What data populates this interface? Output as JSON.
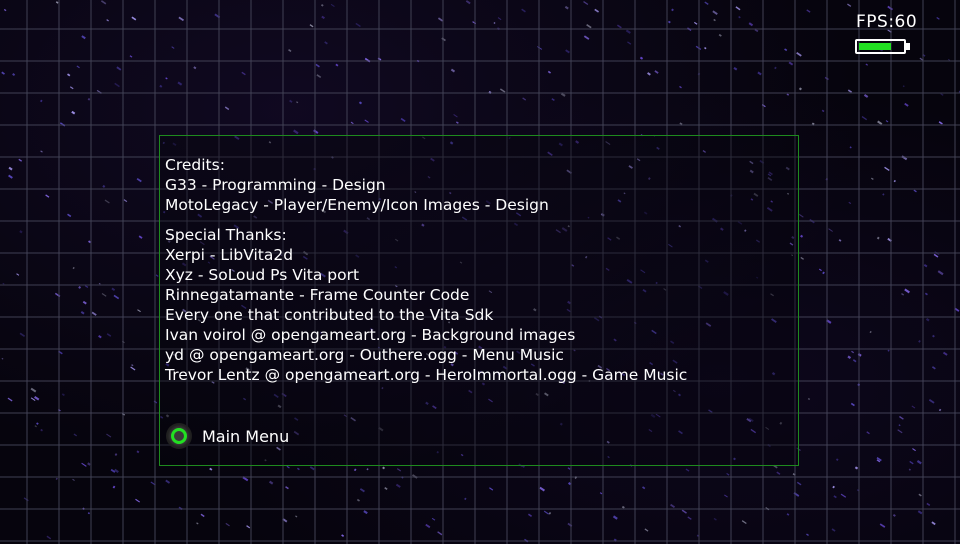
{
  "hud": {
    "fps": "FPS:60",
    "battery_level": 0.75,
    "battery_color": "#22e022"
  },
  "credits": {
    "lines": [
      "Credits:",
      "G33 - Programming - Design",
      "MotoLegacy - Player/Enemy/Icon Images - Design"
    ]
  },
  "thanks": {
    "lines": [
      "Special Thanks:",
      "Xerpi - LibVita2d",
      "Xyz - SoLoud Ps Vita port",
      "Rinnegatamante - Frame Counter Code",
      "Every one that contributed to the Vita Sdk",
      "Ivan voirol @ opengameart.org - Background images",
      "yd @ opengameart.org - Outhere.ogg - Menu Music",
      "Trevor Lentz @ opengameart.org - HeroImmortal.ogg - Game Music"
    ]
  },
  "menu": {
    "button_icon": "circle-button-icon",
    "label": "Main Menu"
  },
  "colors": {
    "panel_border": "#1e8a1e",
    "accent_green": "#22e022"
  }
}
